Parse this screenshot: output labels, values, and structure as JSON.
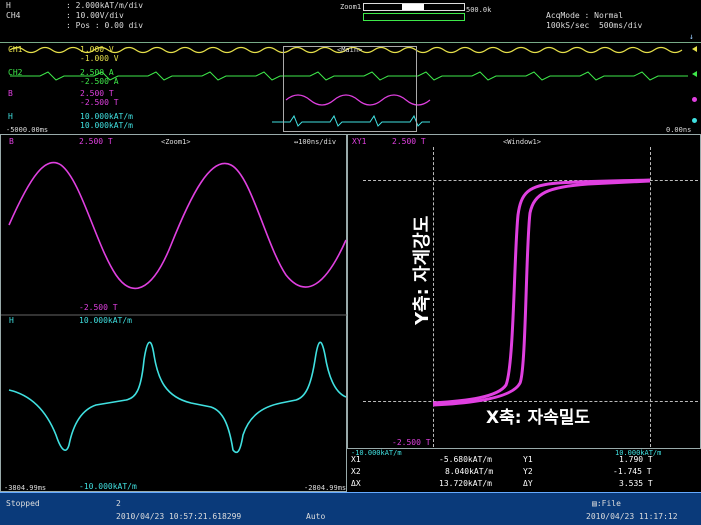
{
  "header": {
    "line1": "H",
    "line1_value": ": 2.000kAT/m/div",
    "line2": "CH4",
    "line2_value": ": 10.00V/div",
    "line3_value": ": Pos : 0.00 div",
    "zoom_label": "Zoom1",
    "zoom_value": "500.0k",
    "acq_mode": "AcqMode : Normal",
    "acq_rate": "100kS/sec  500ms/div"
  },
  "overview": {
    "ch1_label": "CH1",
    "ch1_v1": "1.000 V",
    "ch1_v2": "-1.000 V",
    "ch2_label": "CH2",
    "ch2_v1": "2.500 A",
    "ch2_v2": "-2.500 A",
    "b_label": "B",
    "b_v1": "2.500 T",
    "b_v2": "-2.500 T",
    "h_label": "H",
    "h_v1": "10.000kAT/m",
    "h_v2": "10.000kAT/m",
    "main_label": "<Main>",
    "time_left": "-5000.00ms",
    "time_right": "0.00ns"
  },
  "zoom_panel": {
    "b_label": "B",
    "b_top": "2.500 T",
    "title": "<Zoom1>",
    "time_div": "↔100ns/div",
    "b_bottom": "-2.500 T",
    "h_label": "H",
    "h_top": "10.000kAT/m",
    "h_bottom": "-10.000kAT/m",
    "t_left": "-3804.99ms",
    "t_right": "-2804.99ms"
  },
  "xy_panel": {
    "xy_label": "XY1",
    "y_top": "2.500 T",
    "title": "<Window1>",
    "y_bottom": "-2.500 T",
    "x_left": "-10.000kAT/m",
    "x_right": "10.000kAT/m",
    "y_axis_annotation": "Y축: 자계강도",
    "x_axis_annotation": "X축: 자속밀도"
  },
  "cursors": {
    "x1_label": "X1",
    "x1_value": "-5.680kAT/m",
    "x2_label": "X2",
    "x2_value": "8.040kAT/m",
    "dx_label": "ΔX",
    "dx_value": "13.720kAT/m",
    "y1_label": "Y1",
    "y1_value": "1.790 T",
    "y2_label": "Y2",
    "y2_value": "-1.745 T",
    "dy_label": "ΔY",
    "dy_value": "3.535 T"
  },
  "status": {
    "state": "Stopped",
    "count": "2",
    "timestamp1": "2010/04/23 10:57:21.618299",
    "trigger_mode": "Auto",
    "file_label": "▤:File",
    "timestamp2": "2010/04/23 11:17:12"
  },
  "colors": {
    "ch1": "#e6e04a",
    "ch2": "#3ee84a",
    "b": "#e040e0",
    "h": "#40e0e0",
    "status_bg": "#0a3a7a"
  }
}
